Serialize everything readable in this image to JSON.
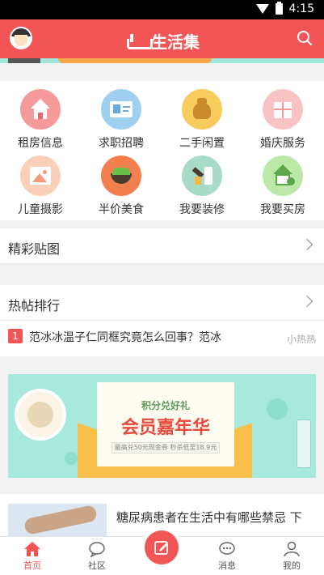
{
  "status_bar": {
    "time": "4:15",
    "wifi_icon": "wifi-icon",
    "battery_icon": "battery-icon"
  },
  "header": {
    "title": "生活集",
    "avatar_icon": "avatar-icon",
    "search_icon": "search-icon"
  },
  "categories": [
    {
      "label": "租房信息",
      "icon": "house-icon",
      "color": "#f59a9a"
    },
    {
      "label": "求职招聘",
      "icon": "id-card-icon",
      "color": "#9fd0f0"
    },
    {
      "label": "二手闲置",
      "icon": "money-bag-icon",
      "color": "#f7cc5c"
    },
    {
      "label": "婚庆服务",
      "icon": "gift-icon",
      "color": "#f9c3c3"
    },
    {
      "label": "儿童摄影",
      "icon": "photo-icon",
      "color": "#fbd0b8"
    },
    {
      "label": "半价美食",
      "icon": "food-bowl-icon",
      "color": "#f47f4e"
    },
    {
      "label": "我要装修",
      "icon": "paint-brush-icon",
      "color": "#a9dcc8"
    },
    {
      "label": "我要买房",
      "icon": "house-yen-icon",
      "color": "#bce8a8"
    }
  ],
  "sections": {
    "pictures": "精彩贴图",
    "hot_posts": "热帖排行"
  },
  "hot_post": {
    "rank": "1",
    "title": "范冰冰温子仁同框究竟怎么回事？范冰",
    "author": "小热热"
  },
  "promo": {
    "caption": "积分兑好礼",
    "headline": "会员嘉年华",
    "coupon_text": "最高兑50元现金券  秒杀低至18.9元"
  },
  "article": {
    "title": "糖尿病患者在生活中有哪些禁忌 下"
  },
  "tabs": [
    {
      "label": "首页",
      "icon": "home-icon",
      "active": true
    },
    {
      "label": "社区",
      "icon": "chat-bubble-icon",
      "active": false
    },
    {
      "label": "消息",
      "icon": "message-icon",
      "active": false
    },
    {
      "label": "我的",
      "icon": "user-icon",
      "active": false
    }
  ],
  "post_button_icon": "edit-icon",
  "colors": {
    "brand": "#f25556",
    "promo_bg": "#a7e9da"
  }
}
